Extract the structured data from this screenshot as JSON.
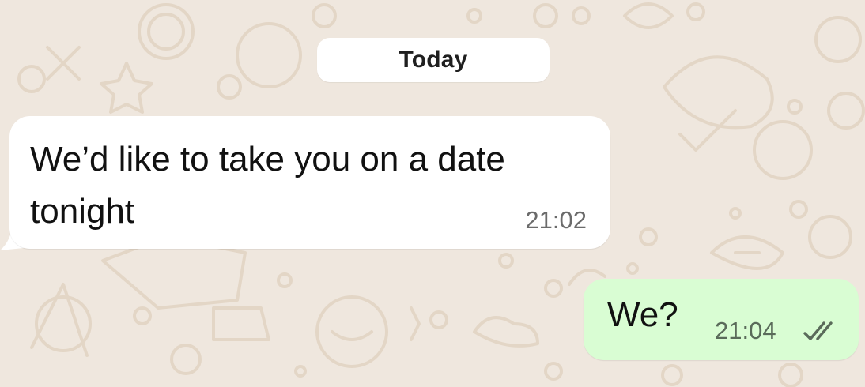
{
  "chat": {
    "date_separator": "Today",
    "messages": [
      {
        "direction": "incoming",
        "text": "We’d like to take you on a date tonight",
        "time": "21:02"
      },
      {
        "direction": "outgoing",
        "text": "We?",
        "time": "21:04",
        "status_icon": "double-check-icon"
      }
    ]
  },
  "colors": {
    "wallpaper": "#efe7de",
    "wallpaper_doodle": "#e3d6c6",
    "incoming_bubble": "#ffffff",
    "outgoing_bubble": "#d9fdd3",
    "date_chip": "#ffffff",
    "read_ticks": "#5a6b5a"
  }
}
